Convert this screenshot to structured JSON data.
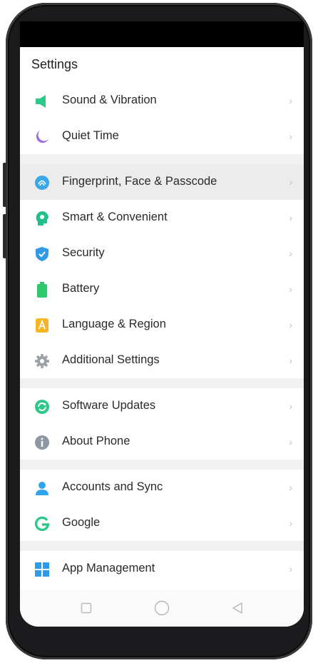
{
  "header": {
    "title": "Settings"
  },
  "chevron": "›",
  "groups": [
    {
      "items": [
        {
          "label": "Sound & Vibration",
          "icon": "speaker-icon",
          "color": "#2ec98a"
        },
        {
          "label": "Quiet Time",
          "icon": "moon-icon",
          "color": "#9b6be0"
        }
      ]
    },
    {
      "items": [
        {
          "label": "Fingerprint, Face & Passcode",
          "icon": "fingerprint-icon",
          "color": "#3aa8e8",
          "active": true
        },
        {
          "label": "Smart & Convenient",
          "icon": "smart-head-icon",
          "color": "#21c08b"
        },
        {
          "label": "Security",
          "icon": "shield-icon",
          "color": "#2f9ae6"
        },
        {
          "label": "Battery",
          "icon": "battery-icon",
          "color": "#2ec96e"
        },
        {
          "label": "Language & Region",
          "icon": "language-icon",
          "color": "#f5b623"
        },
        {
          "label": "Additional Settings",
          "icon": "gear-icon",
          "color": "#9aa0a6"
        }
      ]
    },
    {
      "items": [
        {
          "label": "Software Updates",
          "icon": "update-icon",
          "color": "#2ec98a"
        },
        {
          "label": "About Phone",
          "icon": "info-icon",
          "color": "#8e98a4"
        }
      ]
    },
    {
      "items": [
        {
          "label": "Accounts and Sync",
          "icon": "person-icon",
          "color": "#2fa6ec"
        },
        {
          "label": "Google",
          "icon": "google-icon",
          "color": "#2ec98a"
        }
      ]
    },
    {
      "items": [
        {
          "label": "App Management",
          "icon": "app-grid-icon",
          "color": "#2f9ae6"
        }
      ]
    }
  ],
  "navbar": {
    "recents_icon": "square-icon",
    "home_icon": "circle-icon",
    "back_icon": "triangle-back-icon"
  }
}
